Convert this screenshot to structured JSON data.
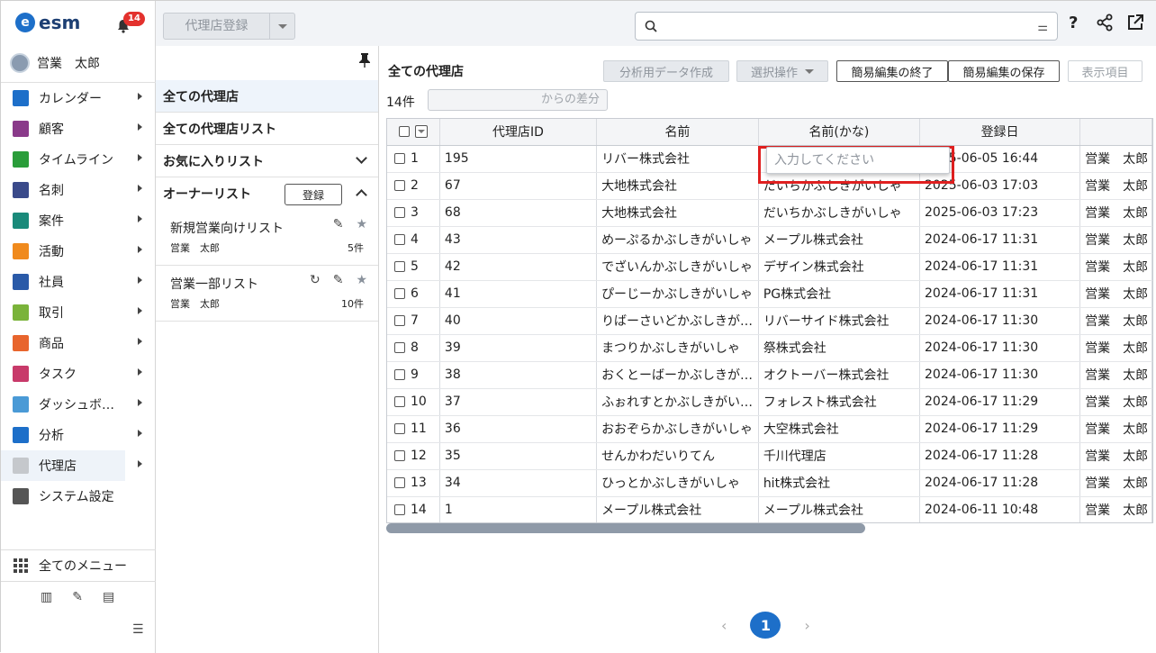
{
  "app": {
    "logo_text": "esm",
    "logo_mark": "e",
    "notification_count": "14",
    "user_name": "営業　太郎"
  },
  "nav": {
    "items": [
      {
        "label": "カレンダー",
        "icon": "calendar-icon",
        "color": "#1d6fc9"
      },
      {
        "label": "顧客",
        "icon": "customer-icon",
        "color": "#8a3a8a"
      },
      {
        "label": "タイムライン",
        "icon": "timeline-icon",
        "color": "#2a9d3a"
      },
      {
        "label": "名刺",
        "icon": "business-card-icon",
        "color": "#3a4a8a"
      },
      {
        "label": "案件",
        "icon": "deal-icon",
        "color": "#1a8a7a"
      },
      {
        "label": "活動",
        "icon": "activity-icon",
        "color": "#f08a1d"
      },
      {
        "label": "社員",
        "icon": "employee-icon",
        "color": "#2a5aa8"
      },
      {
        "label": "取引",
        "icon": "transaction-icon",
        "color": "#7ab33a"
      },
      {
        "label": "商品",
        "icon": "product-icon",
        "color": "#e8652d"
      },
      {
        "label": "タスク",
        "icon": "task-icon",
        "color": "#c83a6a"
      },
      {
        "label": "ダッシュボ…",
        "icon": "dashboard-icon",
        "color": "#4a9ad6"
      },
      {
        "label": "分析",
        "icon": "analysis-icon",
        "color": "#1d6fc9"
      },
      {
        "label": "代理店",
        "icon": "agency-icon",
        "color": "#c5c8cc"
      },
      {
        "label": "システム設定",
        "icon": "gear-icon",
        "color": "#555555"
      }
    ],
    "all_menu": "全てのメニュー"
  },
  "toolbar": {
    "register_label": "代理店登録",
    "help": "?",
    "share": "⋖",
    "open": "⧉"
  },
  "lists": {
    "all_agencies": "全ての代理店",
    "all_agency_lists": "全ての代理店リスト",
    "favorites": "お気に入りリスト",
    "owner_lists": "オーナーリスト",
    "register": "登録",
    "saved": [
      {
        "title": "新規営業向けリスト",
        "owner": "営業　太郎",
        "count": "5件"
      },
      {
        "title": "営業一部リスト",
        "owner": "営業　太郎",
        "count": "10件"
      }
    ]
  },
  "main": {
    "title": "全ての代理店",
    "btn_analysis": "分析用データ作成",
    "btn_select": "選択操作",
    "btn_end_edit": "簡易編集の終了",
    "btn_save_edit": "簡易編集の保存",
    "btn_display": "表示項目",
    "count": "14件",
    "diff_placeholder": "からの差分",
    "popup_placeholder": "入力してください",
    "columns": [
      "代理店ID",
      "名前",
      "名前(かな)",
      "登録日",
      ""
    ],
    "rows": [
      {
        "n": "1",
        "id": "195",
        "name": "リバー株式会社",
        "kana": "",
        "date": "2025-06-05 16:44",
        "owner": "営業　太郎"
      },
      {
        "n": "2",
        "id": "67",
        "name": "大地株式会社",
        "kana": "だいちかぶしきがいしゃ",
        "date": "2025-06-03 17:03",
        "owner": "営業　太郎"
      },
      {
        "n": "3",
        "id": "68",
        "name": "大地株式会社",
        "kana": "だいちかぶしきがいしゃ",
        "date": "2025-06-03 17:23",
        "owner": "営業　太郎"
      },
      {
        "n": "4",
        "id": "43",
        "name": "めーぷるかぶしきがいしゃ",
        "kana": "メープル株式会社",
        "date": "2024-06-17 11:31",
        "owner": "営業　太郎"
      },
      {
        "n": "5",
        "id": "42",
        "name": "でざいんかぶしきがいしゃ",
        "kana": "デザイン株式会社",
        "date": "2024-06-17 11:31",
        "owner": "営業　太郎"
      },
      {
        "n": "6",
        "id": "41",
        "name": "ぴーじーかぶしきがいしゃ",
        "kana": "PG株式会社",
        "date": "2024-06-17 11:31",
        "owner": "営業　太郎"
      },
      {
        "n": "7",
        "id": "40",
        "name": "りばーさいどかぶしきが…",
        "kana": "リバーサイド株式会社",
        "date": "2024-06-17 11:30",
        "owner": "営業　太郎"
      },
      {
        "n": "8",
        "id": "39",
        "name": "まつりかぶしきがいしゃ",
        "kana": "祭株式会社",
        "date": "2024-06-17 11:30",
        "owner": "営業　太郎"
      },
      {
        "n": "9",
        "id": "38",
        "name": "おくとーばーかぶしきが…",
        "kana": "オクトーバー株式会社",
        "date": "2024-06-17 11:30",
        "owner": "営業　太郎"
      },
      {
        "n": "10",
        "id": "37",
        "name": "ふぉれすとかぶしきがい…",
        "kana": "フォレスト株式会社",
        "date": "2024-06-17 11:29",
        "owner": "営業　太郎"
      },
      {
        "n": "11",
        "id": "36",
        "name": "おおぞらかぶしきがいしゃ",
        "kana": "大空株式会社",
        "date": "2024-06-17 11:29",
        "owner": "営業　太郎"
      },
      {
        "n": "12",
        "id": "35",
        "name": "せんかわだいりてん",
        "kana": "千川代理店",
        "date": "2024-06-17 11:28",
        "owner": "営業　太郎"
      },
      {
        "n": "13",
        "id": "34",
        "name": "ひっとかぶしきがいしゃ",
        "kana": "hit株式会社",
        "date": "2024-06-17 11:28",
        "owner": "営業　太郎"
      },
      {
        "n": "14",
        "id": "1",
        "name": "メープル株式会社",
        "kana": "メープル株式会社",
        "date": "2024-06-11 10:48",
        "owner": "営業　太郎"
      }
    ],
    "page": "1"
  }
}
